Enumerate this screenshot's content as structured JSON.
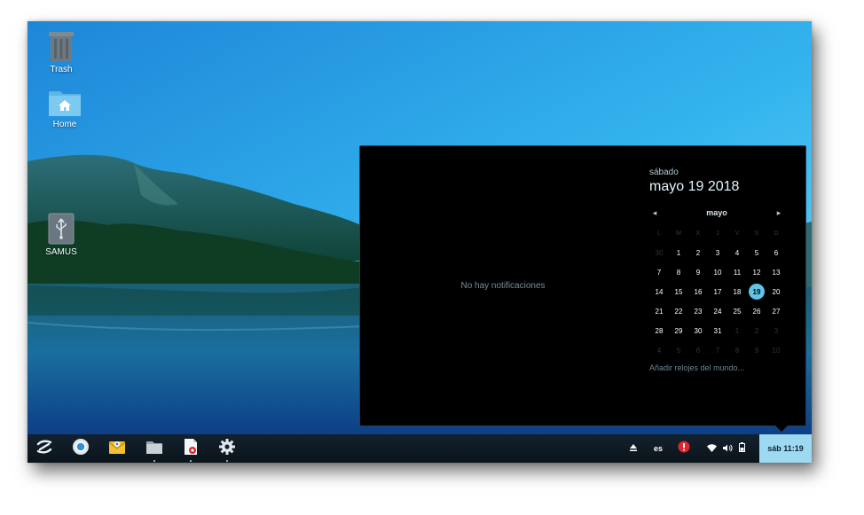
{
  "desktop": {
    "icons": [
      {
        "label": "Trash",
        "icon": "trash-icon"
      },
      {
        "label": "Home",
        "icon": "home-folder-icon"
      },
      {
        "label": "SAMUS",
        "icon": "usb-drive-icon"
      }
    ]
  },
  "notifications": {
    "empty_text": "No hay notificaciones"
  },
  "calendar": {
    "day_name": "sábado",
    "full_date": "mayo 19 2018",
    "month_label": "mayo",
    "prev_icon": "chevron-left-icon",
    "next_icon": "chevron-right-icon",
    "weekdays": [
      "L",
      "M",
      "X",
      "J",
      "V",
      "S",
      "D"
    ],
    "weeks": [
      [
        "30",
        "1",
        "2",
        "3",
        "4",
        "5",
        "6"
      ],
      [
        "7",
        "8",
        "9",
        "10",
        "11",
        "12",
        "13"
      ],
      [
        "14",
        "15",
        "16",
        "17",
        "18",
        "19",
        "20"
      ],
      [
        "21",
        "22",
        "23",
        "24",
        "25",
        "26",
        "27"
      ],
      [
        "28",
        "29",
        "30",
        "31",
        "1",
        "2",
        "3"
      ],
      [
        "4",
        "5",
        "6",
        "7",
        "8",
        "9",
        "10"
      ]
    ],
    "other_month_days": [
      "30",
      "1",
      "2",
      "3",
      "4",
      "5",
      "6",
      "7",
      "8",
      "9",
      "10"
    ],
    "today": "19",
    "world_clocks_link": "Añadir relojes del mundo..."
  },
  "shelf": {
    "apps": [
      {
        "icon": "launcher-icon",
        "running": false
      },
      {
        "icon": "chrome-icon",
        "running": false
      },
      {
        "icon": "email-app-icon",
        "running": false
      },
      {
        "icon": "files-icon",
        "running": true
      },
      {
        "icon": "document-viewer-icon",
        "running": true
      },
      {
        "icon": "settings-icon",
        "running": true
      }
    ]
  },
  "tray": {
    "eject_icon": "eject-icon",
    "language": "es",
    "alert_icon": "alert-icon",
    "wifi_icon": "wifi-icon",
    "volume_icon": "volume-icon",
    "battery_icon": "battery-icon",
    "clock": "sáb 11:19"
  },
  "colors": {
    "accent": "#5fc4e8",
    "clock_bg": "#9ddaf2",
    "alert": "#e0262d"
  }
}
